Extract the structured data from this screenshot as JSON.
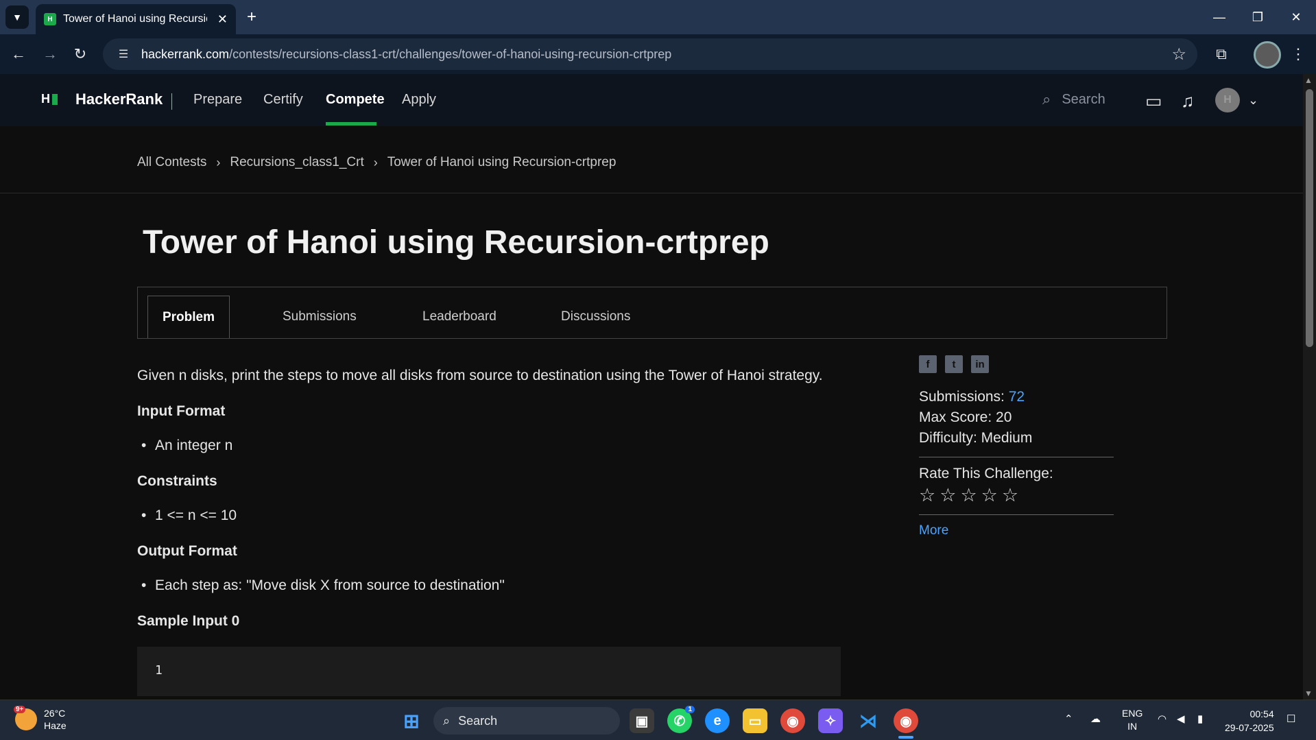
{
  "browser": {
    "tab_title": "Tower of Hanoi using Recursion",
    "url_host": "hackerrank.com",
    "url_path": "/contests/recursions-class1-crt/challenges/tower-of-hanoi-using-recursion-crtprep"
  },
  "header": {
    "brand": "HackerRank",
    "nav": [
      "Prepare",
      "Certify",
      "Compete",
      "Apply"
    ],
    "active_nav": "Compete",
    "search_placeholder": "Search",
    "user_initial": "H"
  },
  "breadcrumb": [
    "All Contests",
    "Recursions_class1_Crt",
    "Tower of Hanoi using Recursion-crtprep"
  ],
  "page_title": "Tower of Hanoi using Recursion-crtprep",
  "tabs": [
    "Problem",
    "Submissions",
    "Leaderboard",
    "Discussions"
  ],
  "problem": {
    "statement": "Given n disks, print the steps to move all disks from source to destination using the Tower of Hanoi strategy.",
    "input_format_h": "Input Format",
    "input_format": "An integer n",
    "constraints_h": "Constraints",
    "constraints": "1 <= n <= 10",
    "output_format_h": "Output Format",
    "output_format": "Each step as: \"Move disk X from source to destination\"",
    "sample_input_h": "Sample Input 0",
    "sample_input": "1"
  },
  "sidebar": {
    "social": [
      "f",
      "t",
      "in"
    ],
    "submissions_label": "Submissions:",
    "submissions_value": "72",
    "max_score_label": "Max Score:",
    "max_score_value": "20",
    "difficulty_label": "Difficulty:",
    "difficulty_value": "Medium",
    "rate_label": "Rate This Challenge:",
    "rating": 0,
    "stars_total": 5,
    "more": "More"
  },
  "taskbar": {
    "weather_temp": "26°C",
    "weather_desc": "Haze",
    "weather_badge": "9+",
    "search": "Search",
    "whatsapp_badge": "1",
    "lang_top": "ENG",
    "lang_bottom": "IN",
    "time": "00:54",
    "date": "29-07-2025"
  },
  "colors": {
    "accent_green": "#1ba94c",
    "link_blue": "#4aa3ff",
    "header_bg": "#0e141e"
  }
}
